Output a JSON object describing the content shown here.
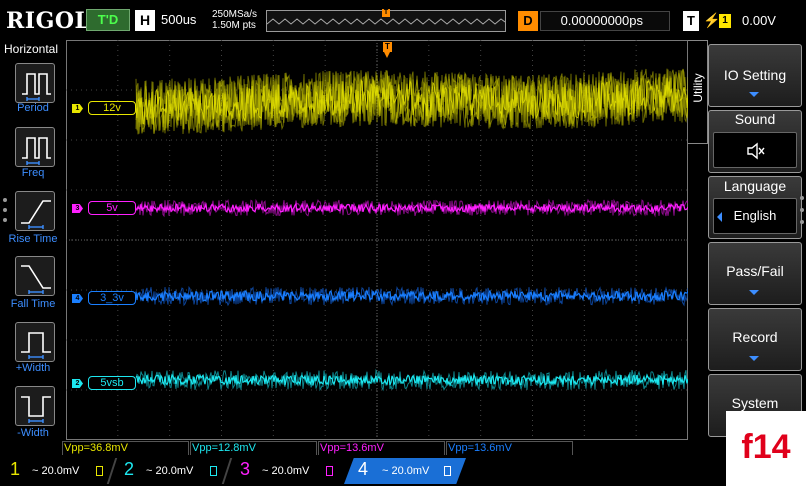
{
  "header": {
    "logo": "RIGOL",
    "run_state": "T'D",
    "horizontal_badge": "H",
    "timebase": "500us",
    "sample_rate": "250MSa/s",
    "memory_depth": "1.50M pts",
    "delay_badge": "D",
    "delay_value": "0.00000000ps",
    "trigger_badge": "T",
    "trigger_source": "1",
    "trigger_level": "0.00V",
    "trigger_marker": "T"
  },
  "left_panel": {
    "title": "Horizontal",
    "items": [
      {
        "label": "Period",
        "icon": "period-icon"
      },
      {
        "label": "Freq",
        "icon": "frequency-icon"
      },
      {
        "label": "Rise Time",
        "icon": "rise-time-icon"
      },
      {
        "label": "Fall Time",
        "icon": "fall-time-icon"
      },
      {
        "label": "+Width",
        "icon": "positive-width-icon"
      },
      {
        "label": "-Width",
        "icon": "negative-width-icon"
      }
    ]
  },
  "channels": [
    {
      "number": "1",
      "label": "12v",
      "color": "#e8e600"
    },
    {
      "number": "3",
      "label": "5v",
      "color": "#ff20ff"
    },
    {
      "number": "4",
      "label": "3_3v",
      "color": "#1a7fff"
    },
    {
      "number": "2",
      "label": "5vsb",
      "color": "#1de8f0"
    }
  ],
  "right_menu": {
    "tab_label": "Utility",
    "io_setting": "IO Setting",
    "sound": "Sound",
    "sound_icon": "speaker-muted-icon",
    "language": "Language",
    "language_value": "English",
    "pass_fail": "Pass/Fail",
    "record": "Record",
    "system": "System"
  },
  "measurements": [
    {
      "text": "Vpp=36.8mV",
      "color": "#e8e600"
    },
    {
      "text": "Vpp=12.8mV",
      "color": "#1de8f0"
    },
    {
      "text": "Vpp=13.6mV",
      "color": "#ff20ff"
    },
    {
      "text": "Vpp=13.6mV",
      "color": "#1a7fff"
    }
  ],
  "bottom_channels": [
    {
      "number": "1",
      "scale": "~ 20.0mV",
      "color": "#e8e600"
    },
    {
      "number": "2",
      "scale": "~ 20.0mV",
      "color": "#1de8f0"
    },
    {
      "number": "3",
      "scale": "~ 20.0mV",
      "color": "#ff20ff"
    },
    {
      "number": "4",
      "scale": "~ 20.0mV",
      "color": "#1a7fff"
    }
  ],
  "page_tag": "f14"
}
